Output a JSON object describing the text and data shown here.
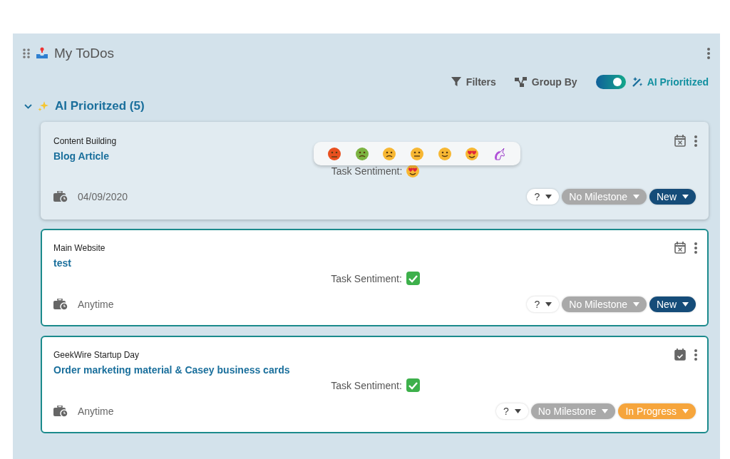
{
  "widget": {
    "title": "My ToDos"
  },
  "toolbar": {
    "filters": "Filters",
    "group_by": "Group By",
    "ai_toggle": {
      "on": true,
      "label": "AI Prioritized"
    }
  },
  "section": {
    "title": "AI Prioritzed (5)",
    "expanded": true
  },
  "tasks": [
    {
      "project": "Content Building",
      "title": "Blog Article",
      "due": "04/09/2020",
      "sentiment_label": "Task Sentiment:",
      "sentiment": {
        "kind": "heart-eyes"
      },
      "picker_open": true,
      "scheduled": false,
      "priority": "?",
      "milestone": "No Milestone",
      "status": {
        "label": "New",
        "color": "#154c79"
      }
    },
    {
      "project": "Main Website",
      "title": "test",
      "due": "Anytime",
      "sentiment_label": "Task Sentiment:",
      "sentiment": {
        "kind": "check"
      },
      "picker_open": false,
      "scheduled": false,
      "priority": "?",
      "milestone": "No Milestone",
      "status": {
        "label": "New",
        "color": "#154c79"
      }
    },
    {
      "project": "GeekWire Startup Day",
      "title": "Order marketing material & Casey business cards",
      "due": "Anytime",
      "sentiment_label": "Task Sentiment:",
      "sentiment": {
        "kind": "check"
      },
      "picker_open": false,
      "scheduled": true,
      "priority": "?",
      "milestone": "No Milestone",
      "status": {
        "label": "In Progress",
        "color": "#f6a53c"
      }
    }
  ]
}
